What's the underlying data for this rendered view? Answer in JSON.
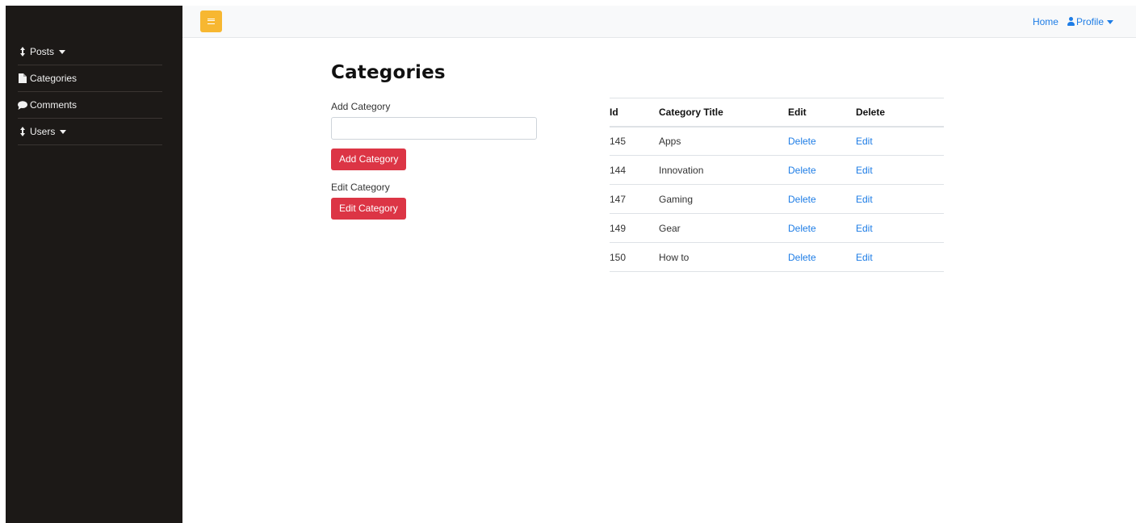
{
  "sidebar": {
    "items": [
      {
        "label": "Posts",
        "icon": "sort-icon",
        "dropdown": true
      },
      {
        "label": "Categories",
        "icon": "file-icon",
        "dropdown": false
      },
      {
        "label": "Comments",
        "icon": "comment-icon",
        "dropdown": false
      },
      {
        "label": "Users",
        "icon": "sort-icon",
        "dropdown": true
      }
    ]
  },
  "topbar": {
    "home_label": "Home",
    "profile_label": "Profile"
  },
  "page": {
    "title": "Categories",
    "add_label": "Add Category",
    "add_input_value": "",
    "add_button": "Add Category",
    "edit_label": "Edit Category",
    "edit_button": "Edit Category"
  },
  "table": {
    "headers": [
      "Id",
      "Category Title",
      "Edit",
      "Delete"
    ],
    "rows": [
      {
        "id": "145",
        "title": "Apps",
        "edit": "Delete",
        "delete": "Edit"
      },
      {
        "id": "144",
        "title": "Innovation",
        "edit": "Delete",
        "delete": "Edit"
      },
      {
        "id": "147",
        "title": "Gaming",
        "edit": "Delete",
        "delete": "Edit"
      },
      {
        "id": "149",
        "title": "Gear",
        "edit": "Delete",
        "delete": "Edit"
      },
      {
        "id": "150",
        "title": "How to",
        "edit": "Delete",
        "delete": "Edit"
      }
    ]
  },
  "colors": {
    "sidebar_bg": "#1c1917",
    "toggle_bg": "#f7b731",
    "danger": "#dc3545",
    "link": "#1e7de6"
  }
}
